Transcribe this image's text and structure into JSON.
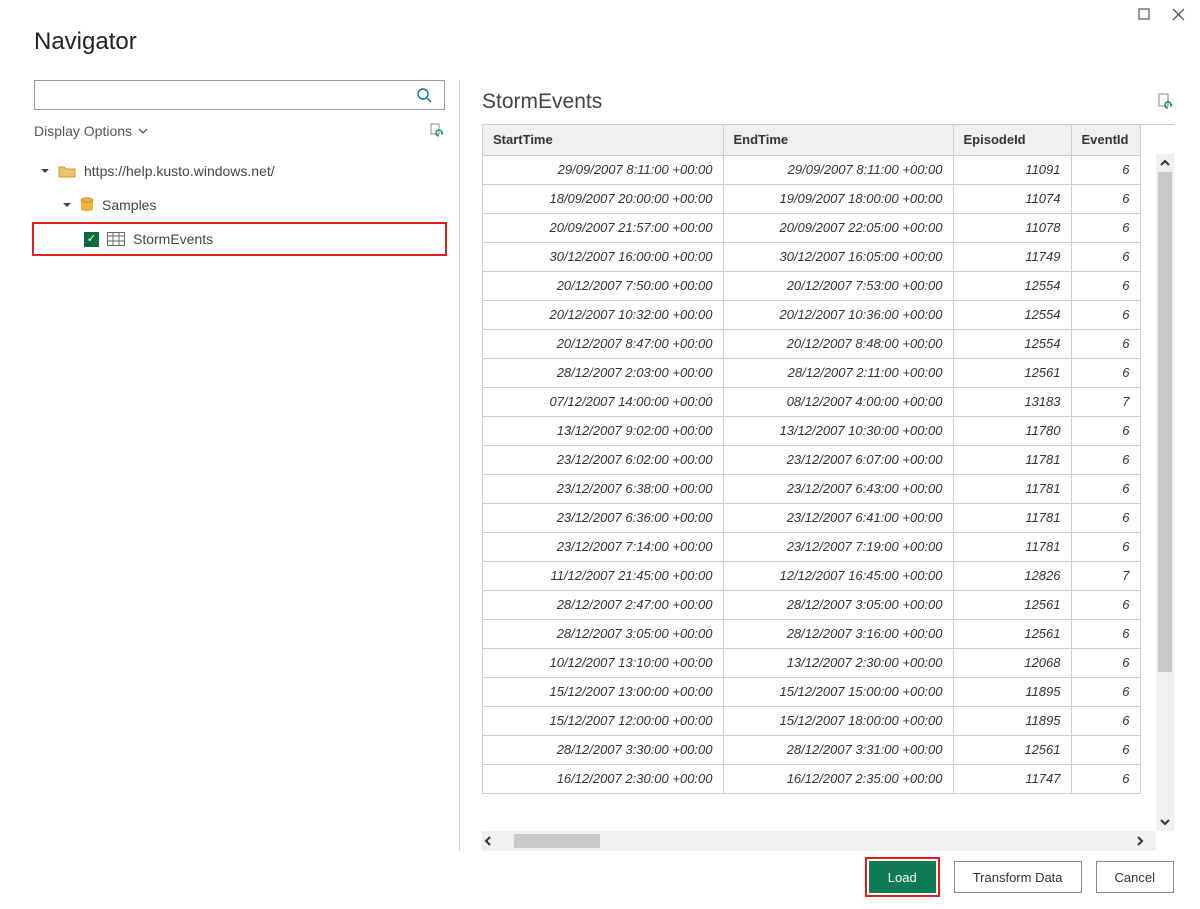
{
  "window": {
    "title": "Navigator"
  },
  "sidebar": {
    "display_options_label": "Display Options",
    "tree": {
      "root_label": "https://help.kusto.windows.net/",
      "db_label": "Samples",
      "table_label": "StormEvents",
      "table_checked": true
    }
  },
  "preview": {
    "title": "StormEvents",
    "columns": [
      "StartTime",
      "EndTime",
      "EpisodeId",
      "EventId"
    ],
    "rows": [
      {
        "StartTime": "29/09/2007 8:11:00 +00:00",
        "EndTime": "29/09/2007 8:11:00 +00:00",
        "EpisodeId": "11091",
        "EventId": "6"
      },
      {
        "StartTime": "18/09/2007 20:00:00 +00:00",
        "EndTime": "19/09/2007 18:00:00 +00:00",
        "EpisodeId": "11074",
        "EventId": "6"
      },
      {
        "StartTime": "20/09/2007 21:57:00 +00:00",
        "EndTime": "20/09/2007 22:05:00 +00:00",
        "EpisodeId": "11078",
        "EventId": "6"
      },
      {
        "StartTime": "30/12/2007 16:00:00 +00:00",
        "EndTime": "30/12/2007 16:05:00 +00:00",
        "EpisodeId": "11749",
        "EventId": "6"
      },
      {
        "StartTime": "20/12/2007 7:50:00 +00:00",
        "EndTime": "20/12/2007 7:53:00 +00:00",
        "EpisodeId": "12554",
        "EventId": "6"
      },
      {
        "StartTime": "20/12/2007 10:32:00 +00:00",
        "EndTime": "20/12/2007 10:36:00 +00:00",
        "EpisodeId": "12554",
        "EventId": "6"
      },
      {
        "StartTime": "20/12/2007 8:47:00 +00:00",
        "EndTime": "20/12/2007 8:48:00 +00:00",
        "EpisodeId": "12554",
        "EventId": "6"
      },
      {
        "StartTime": "28/12/2007 2:03:00 +00:00",
        "EndTime": "28/12/2007 2:11:00 +00:00",
        "EpisodeId": "12561",
        "EventId": "6"
      },
      {
        "StartTime": "07/12/2007 14:00:00 +00:00",
        "EndTime": "08/12/2007 4:00:00 +00:00",
        "EpisodeId": "13183",
        "EventId": "7"
      },
      {
        "StartTime": "13/12/2007 9:02:00 +00:00",
        "EndTime": "13/12/2007 10:30:00 +00:00",
        "EpisodeId": "11780",
        "EventId": "6"
      },
      {
        "StartTime": "23/12/2007 6:02:00 +00:00",
        "EndTime": "23/12/2007 6:07:00 +00:00",
        "EpisodeId": "11781",
        "EventId": "6"
      },
      {
        "StartTime": "23/12/2007 6:38:00 +00:00",
        "EndTime": "23/12/2007 6:43:00 +00:00",
        "EpisodeId": "11781",
        "EventId": "6"
      },
      {
        "StartTime": "23/12/2007 6:36:00 +00:00",
        "EndTime": "23/12/2007 6:41:00 +00:00",
        "EpisodeId": "11781",
        "EventId": "6"
      },
      {
        "StartTime": "23/12/2007 7:14:00 +00:00",
        "EndTime": "23/12/2007 7:19:00 +00:00",
        "EpisodeId": "11781",
        "EventId": "6"
      },
      {
        "StartTime": "11/12/2007 21:45:00 +00:00",
        "EndTime": "12/12/2007 16:45:00 +00:00",
        "EpisodeId": "12826",
        "EventId": "7"
      },
      {
        "StartTime": "28/12/2007 2:47:00 +00:00",
        "EndTime": "28/12/2007 3:05:00 +00:00",
        "EpisodeId": "12561",
        "EventId": "6"
      },
      {
        "StartTime": "28/12/2007 3:05:00 +00:00",
        "EndTime": "28/12/2007 3:16:00 +00:00",
        "EpisodeId": "12561",
        "EventId": "6"
      },
      {
        "StartTime": "10/12/2007 13:10:00 +00:00",
        "EndTime": "13/12/2007 2:30:00 +00:00",
        "EpisodeId": "12068",
        "EventId": "6"
      },
      {
        "StartTime": "15/12/2007 13:00:00 +00:00",
        "EndTime": "15/12/2007 15:00:00 +00:00",
        "EpisodeId": "11895",
        "EventId": "6"
      },
      {
        "StartTime": "15/12/2007 12:00:00 +00:00",
        "EndTime": "15/12/2007 18:00:00 +00:00",
        "EpisodeId": "11895",
        "EventId": "6"
      },
      {
        "StartTime": "28/12/2007 3:30:00 +00:00",
        "EndTime": "28/12/2007 3:31:00 +00:00",
        "EpisodeId": "12561",
        "EventId": "6"
      },
      {
        "StartTime": "16/12/2007 2:30:00 +00:00",
        "EndTime": "16/12/2007 2:35:00 +00:00",
        "EpisodeId": "11747",
        "EventId": "6"
      }
    ]
  },
  "footer": {
    "load_label": "Load",
    "transform_label": "Transform Data",
    "cancel_label": "Cancel"
  }
}
